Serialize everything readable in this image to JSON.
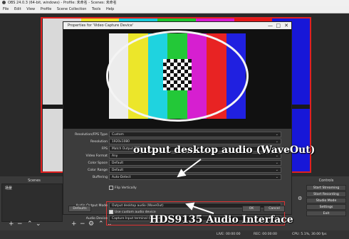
{
  "window_title": "OBS 24.0.3 (64-bit, windows) - Profile: 未命名 - Scenes: 未命名",
  "menu": [
    "File",
    "Edit",
    "View",
    "Profile",
    "Scene Collection",
    "Tools",
    "Help"
  ],
  "preview_bar_colors": [
    "#d9d9d9",
    "#e6e12a",
    "#16c9d8",
    "#1cc32d",
    "#d51ad0",
    "#e31818",
    "#1717d8"
  ],
  "dialog": {
    "title": "Properties for 'Video Capture Device'",
    "controls": {
      "minimize": "—",
      "maximize": "□",
      "close": "✕"
    },
    "preview_bar_colors": [
      "#ececec",
      "#ece62a",
      "#1fd3df",
      "#23c838",
      "#d61fd0",
      "#e82323",
      "#2020e0"
    ],
    "fields": [
      {
        "label": "Resolution/FPS Type",
        "value": "Custom"
      },
      {
        "label": "Resolution",
        "value": "1920x1080"
      },
      {
        "label": "FPS",
        "value": "Match Output FPS"
      },
      {
        "label": "Video Format",
        "value": "Any"
      },
      {
        "label": "Color Space",
        "value": "Default"
      },
      {
        "label": "Color Range",
        "value": "Default"
      },
      {
        "label": "Buffering",
        "value": "Auto-Detect"
      }
    ],
    "flip_vertically": "Flip Vertically",
    "audio_output_mode": {
      "label": "Audio Output Mode",
      "value": "Output desktop audio (WaveOut)"
    },
    "use_custom_audio": "Use custom audio device",
    "audio_device": {
      "label": "Audio Device",
      "value": "Capture Input terminal (Device)"
    },
    "buttons": {
      "defaults": "Defaults",
      "ok": "OK",
      "cancel": "Cancel"
    }
  },
  "docks": {
    "scenes_title": "Scenes",
    "scene_item": "场景",
    "controls_title": "Controls",
    "controls": [
      "Start Streaming",
      "Start Recording",
      "Studio Mode",
      "Settings",
      "Exit"
    ]
  },
  "status": {
    "live": "LIVE: 00:00:00",
    "rec": "REC: 00:00:00",
    "cpu": "CPU: 5.1%, 30.00 fps"
  },
  "annotations": {
    "wave_out": "output desktop audio (WaveOut)",
    "interface": "HDS9135 Audio Interface"
  }
}
